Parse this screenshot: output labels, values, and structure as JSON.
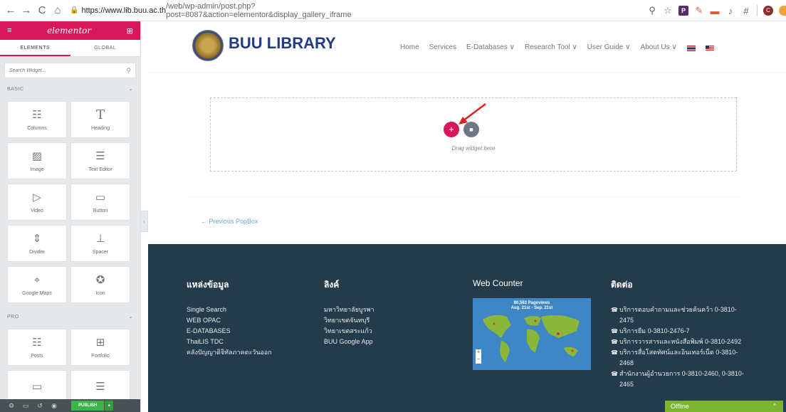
{
  "browser": {
    "url_host": "https://www.lib.buu.ac.th",
    "url_rest": "/web/wp-admin/post.php?post=8087&action=elementor&display_gallery_iframe"
  },
  "panel": {
    "logo": "elementor",
    "tabs": [
      "ELEMENTS",
      "GLOBAL"
    ],
    "search_placeholder": "Search Widget...",
    "basic_label": "BASIC",
    "pro_label": "PRO",
    "basic_widgets": [
      {
        "label": "Columns",
        "icon": "columns-icon"
      },
      {
        "label": "Heading",
        "icon": "heading-icon"
      },
      {
        "label": "Image",
        "icon": "image-icon"
      },
      {
        "label": "Text Editor",
        "icon": "text-editor-icon"
      },
      {
        "label": "Video",
        "icon": "video-icon"
      },
      {
        "label": "Button",
        "icon": "button-icon"
      },
      {
        "label": "Divider",
        "icon": "divider-icon"
      },
      {
        "label": "Spacer",
        "icon": "spacer-icon"
      },
      {
        "label": "Google Maps",
        "icon": "google-maps-icon"
      },
      {
        "label": "Icon",
        "icon": "star-icon"
      }
    ],
    "pro_widgets": [
      {
        "label": "Posts",
        "icon": "posts-icon"
      },
      {
        "label": "Portfolio",
        "icon": "portfolio-icon"
      },
      {
        "label": "",
        "icon": "slides-icon"
      },
      {
        "label": "",
        "icon": "form-icon"
      }
    ],
    "publish_label": "PUBLISH"
  },
  "site": {
    "title": "BUU LIBRARY",
    "nav": [
      "Home",
      "Services",
      "E-Databases ∨",
      "Research Tool ∨",
      "User Guide ∨",
      "About Us ∨"
    ],
    "drag_text": "Drag widget here",
    "prev_link": "← Previous PopBox"
  },
  "footer": {
    "col1_title": "แหล่งข้อมูล",
    "col1_links": [
      "Single Search",
      "WEB OPAC",
      "E-DATABASES",
      "ThaiLIS TDC",
      "คลังปัญญาดิจิทัลภาคตะวันออก"
    ],
    "col2_title": "ลิงค์",
    "col2_links": [
      "มหาวิทยาลัยบูรพา",
      "วิทยาเขตจันทบุรี",
      "วิทยาเขตสระแก้ว",
      "BUU Google App"
    ],
    "col3_title": "Web Counter",
    "counter_line1": "80,563 Pageviews",
    "counter_line2": "Aug. 21st - Sep. 21st",
    "col4_title": "ติดต่อ",
    "contacts": [
      "บริการตอบคำถามและช่วยค้นคว้า 0-3810-2475",
      "บริการยืม 0-3810-2476-7",
      "บริการวารสารและหนังสือพิมพ์ 0-3810-2492",
      "บริการสื่อโสตทัศน์และอินเทอร์เน็ต 0-3810-2468",
      "สำนักงานผู้อำนวยการ 0-3810-2460, 0-3810-2465"
    ]
  },
  "chat": {
    "label": "Offline"
  }
}
